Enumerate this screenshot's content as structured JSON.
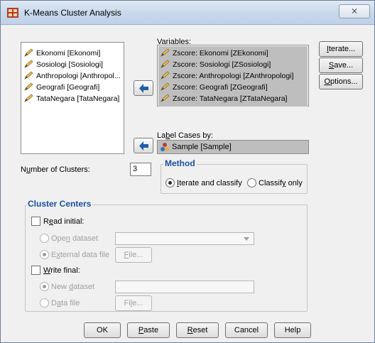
{
  "window": {
    "title": "K-Means Cluster Analysis",
    "close_label": "⨯"
  },
  "source_list": {
    "items": [
      {
        "label": "Ekonomi [Ekonomi]"
      },
      {
        "label": "Sosiologi [Sosiologi]"
      },
      {
        "label": "Anthropologi [Anthropol..."
      },
      {
        "label": "Geografi [Geografi]"
      },
      {
        "label": "TataNegara [TataNegara]"
      }
    ]
  },
  "variables": {
    "label_pre": "",
    "label_u": "V",
    "label_post": "ariables:",
    "items": [
      {
        "label": "Zscore:  Ekonomi [ZEkonomi]"
      },
      {
        "label": "Zscore:  Sosiologi [ZSosiologi]"
      },
      {
        "label": "Zscore:  Anthropologi [ZAnthropologi]"
      },
      {
        "label": "Zscore:  Geografi [ZGeografi]"
      },
      {
        "label": "Zscore:  TataNegara [ZTataNegara]"
      }
    ]
  },
  "label_cases": {
    "label_pre": "La",
    "label_u": "b",
    "label_post": "el Cases by:",
    "value": "Sample [Sample]"
  },
  "side_buttons": {
    "iterate": {
      "pre": "",
      "u": "I",
      "post": "terate..."
    },
    "save": {
      "pre": "",
      "u": "S",
      "post": "ave..."
    },
    "options": {
      "pre": "",
      "u": "O",
      "post": "ptions..."
    }
  },
  "clusters": {
    "label_pre": "N",
    "label_u": "u",
    "label_post": "mber of Clusters:",
    "value": "3"
  },
  "method": {
    "title": "Method",
    "option1": {
      "pre": "",
      "u": "I",
      "post": "terate and classify"
    },
    "option2": {
      "pre": "Classif",
      "u": "y",
      "post": " only"
    }
  },
  "cluster_centers": {
    "title": "Cluster Centers",
    "read_initial": {
      "pre": "R",
      "u": "e",
      "post": "ad initial:"
    },
    "open_dataset": {
      "pre": "Ope",
      "u": "n",
      "post": " dataset"
    },
    "external_file": {
      "pre": "E",
      "u": "x",
      "post": "ternal data file"
    },
    "file_button1": {
      "pre": "",
      "u": "F",
      "post": "ile..."
    },
    "write_final": {
      "pre": "",
      "u": "W",
      "post": "rite final:"
    },
    "new_dataset": {
      "pre": "New ",
      "u": "d",
      "post": "ataset"
    },
    "data_file": {
      "pre": "D",
      "u": "a",
      "post": "ta file"
    },
    "file_button2": {
      "pre": "Fi",
      "u": "l",
      "post": "e..."
    }
  },
  "bottom_buttons": {
    "ok": "OK",
    "paste": {
      "pre": "",
      "u": "P",
      "post": "aste"
    },
    "reset": {
      "pre": "",
      "u": "R",
      "post": "eset"
    },
    "cancel": "Cancel",
    "help": "Help"
  },
  "colors": {
    "selection": "#bebebe",
    "group_title": "#1c4fa0",
    "arrow": "#1f5fa8"
  }
}
